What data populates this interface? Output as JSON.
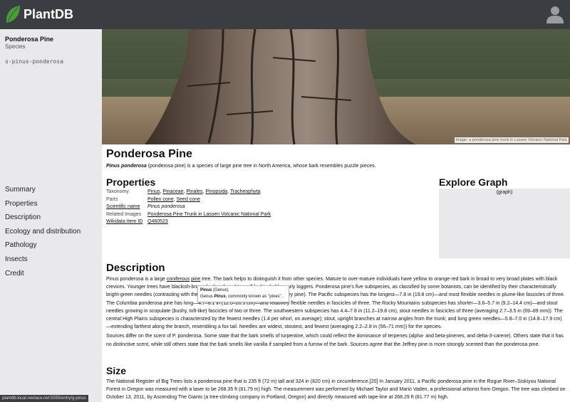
{
  "app": {
    "brand": "PlantDB",
    "accent": "#4a9b3c",
    "topbar_color": "#3a3d42"
  },
  "sidebar": {
    "title": "Ponderosa Pine",
    "subtitle": "Species",
    "slug": "s-pinus-ponderosa",
    "nav": [
      "Summary",
      "Properties",
      "Description",
      "Ecology and distribution",
      "Pathology",
      "Insects",
      "Credit"
    ]
  },
  "hero": {
    "caption": "Image: a ponderosa pine trunk in Lassen Volcanic National Park"
  },
  "page": {
    "title": "Ponderosa Pine",
    "intro_bold": "Pinus ponderosa",
    "intro_rest": " (ponderosa pine) is a species of large pine tree in North America, whose bark resembles puzzle pieces."
  },
  "properties": {
    "heading": "Properties",
    "rows": [
      {
        "key": "Taxonomy",
        "links": [
          "Pinus",
          "Pinaceae",
          "Pinales",
          "Pinopsida",
          "Tracheophyta"
        ]
      },
      {
        "key": "Parts",
        "links": [
          "Pollen cone",
          "Seed cone"
        ]
      },
      {
        "key": "Scientific name",
        "value": "Pinus ponderosa"
      },
      {
        "key": "Related Images",
        "links": [
          "Ponderosa Pine Trunk in Lassen Volcanic National Park"
        ]
      },
      {
        "key": "Wikidata Item ID",
        "links": [
          "Q460523"
        ]
      }
    ]
  },
  "graph": {
    "heading": "Explore Graph",
    "placeholder": "(graph)"
  },
  "description": {
    "heading": "Description",
    "p1_start": "Pinus ponderosa is a large ",
    "p1_link1": "coniferous",
    "p1_mid": " ",
    "p1_link2": "pine",
    "p1_rest": " tree. The bark helps to distinguish it from other species. Mature to over-mature individuals have yellow to orange-red bark in broad to very broad plates with black crevices. Younger trees have blackish-brown bark, referred to as \"blackjacks\" by early loggers. Ponderosa pine's five subspecies, as classified by some botanists, can be identified by their characteristically bright-green needles (contrasting with the blue-green needles that distinguish Jeffrey pine). The Pacific subspecies has the longest—7.8 in (19.8 cm)—and most flexible needles in plume-like fascicles of three. The Columbia ponderosa pine has long—4.7–8.1 in (12.0–20.5 cm)—and relatively flexible needles in fascicles of three. The Rocky Mountains subspecies has shorter—3.6–5.7 in (9.2–14.4 cm)—and stout needles growing in scopulate (bushy, tuft-like) fascicles of two or three. The southwestern subspecies has 4.4–7.8 in (11.2–19.8 cm), stout needles in fascicles of three (averaging 2.7–3.5 in (69–89 mm)). The central High Plains subspecies is characterized by the fewest needles (1.4 per whorl, on average); stout, upright branches at narrow angles from the trunk; and long green needles—5.8–7.0 in (14.8–17.9 cm)—extending farthest along the branch, resembling a fox tail. Needles are widest, stoutest, and fewest (averaging 2.2–2.8 in (56–71 mm)) for the species.",
    "p2": "Sources differ on the scent of P. ponderosa. Some state that the bark smells of turpentine, which could reflect the dominance of terpenes (alpha- and beta-pinenes, and delta-3-carene). Others state that it has no distinctive scent, while still others state that the bark smells like vanilla if sampled from a furrow of the bark. Sources agree that the Jeffrey pine is more strongly scented than the ponderosa pine."
  },
  "size": {
    "heading": "Size",
    "p1": "The National Register of Big Trees lists a ponderosa pine that is 235 ft (72 m) tall and 324 in (820 cm) in circumference.[20] In January 2011, a Pacific ponderosa pine in the Rogue River–Siskiyou National Forest in Oregon was measured with a laser to be 268.35 ft (81.79 m) high. The measurement was performed by Michael Taylor and Mario Vaden, a professional arborist from Oregon. The tree was climbed on October 13, 2011, by Ascending The Giants (a tree-climbing company in Portland, Oregon) and directly measured with tape-line at 268.29 ft (81.77 m) high."
  },
  "tooltip": {
    "title": "Pinus",
    "title_suffix": " (Genus)",
    "line_prefix": "Genus ",
    "line_bold": "Pinus",
    "line_rest": ", commonly known as \"pines\"."
  },
  "statusbar": {
    "url": "plantdb.local.neolace.net:5555/entry/g-pinus"
  }
}
